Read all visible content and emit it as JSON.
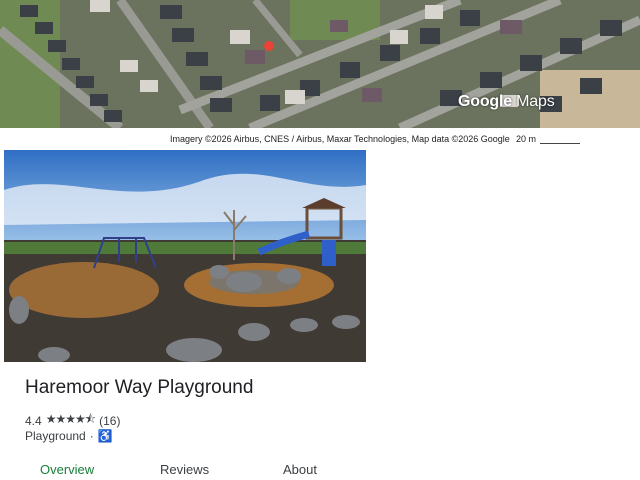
{
  "map": {
    "logo_bold": "Google",
    "logo_rest": " Maps",
    "pin_color": "#ea4335"
  },
  "attribution": {
    "text": "Imagery ©2026 Airbus, CNES / Airbus, Maxar Technologies, Map data ©2026 Google",
    "scale_label": "20 m"
  },
  "place": {
    "name": "Haremoor Way Playground",
    "rating": "4.4",
    "stars": "★★★★⯪",
    "review_count": "(16)",
    "category": "Playground",
    "separator": "·",
    "accessibility_icon": "wheelchair-icon"
  },
  "tabs": [
    {
      "label": "Overview",
      "active": true
    },
    {
      "label": "Reviews",
      "active": false
    },
    {
      "label": "About",
      "active": false
    }
  ],
  "colors": {
    "active_tab": "#188038",
    "accessible_icon": "#1a73e8"
  }
}
